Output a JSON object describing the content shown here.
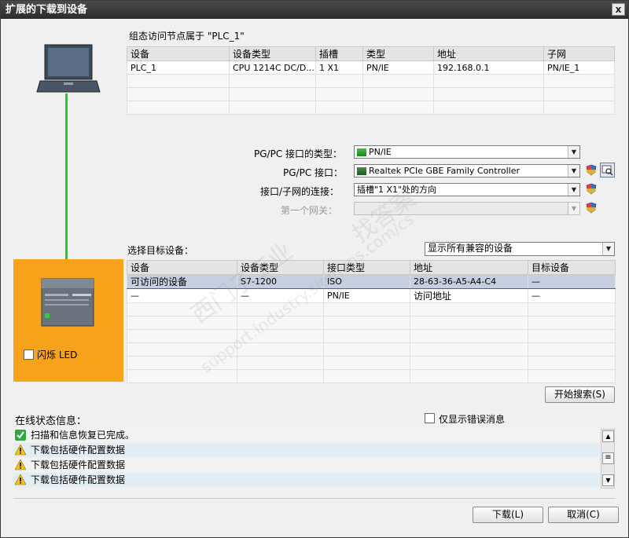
{
  "window": {
    "title": "扩展的下载到设备",
    "close_glyph": "x"
  },
  "config_table": {
    "caption": "组态访问节点属于 \"PLC_1\"",
    "headers": [
      "设备",
      "设备类型",
      "插槽",
      "类型",
      "地址",
      "子网"
    ],
    "rows": [
      [
        "PLC_1",
        "CPU 1214C DC/D...",
        "1 X1",
        "PN/IE",
        "192.168.0.1",
        "PN/IE_1"
      ]
    ]
  },
  "interface": {
    "type_label": "PG/PC 接口的类型：",
    "type_value": "PN/IE",
    "pgpc_label": "PG/PC 接口：",
    "pgpc_value": "Realtek PCIe GBE Family Controller",
    "conn_label": "接口/子网的连接：",
    "conn_value": "插槽\"1 X1\"处的方向",
    "gateway_label": "第一个网关：",
    "gateway_value": ""
  },
  "target": {
    "label": "选择目标设备：",
    "filter_value": "显示所有兼容的设备",
    "headers": [
      "设备",
      "设备类型",
      "接口类型",
      "地址",
      "目标设备"
    ],
    "rows": [
      [
        "可访问的设备",
        "S7-1200",
        "ISO",
        "28-63-36-A5-A4-C4",
        "—"
      ],
      [
        "—",
        "—",
        "PN/IE",
        "访问地址",
        "—"
      ]
    ]
  },
  "flash_led_label": "闪烁 LED",
  "start_search_label": "开始搜索(S)",
  "status": {
    "title": "在线状态信息：",
    "only_errors_label": "仅显示错误消息",
    "messages": [
      {
        "icon": "check-icon",
        "text": "扫描和信息恢复已完成。"
      },
      {
        "icon": "warning-icon",
        "text": "下载包括硬件配置数据"
      },
      {
        "icon": "warning-icon",
        "text": "下载包括硬件配置数据"
      },
      {
        "icon": "warning-icon",
        "text": "下载包括硬件配置数据"
      }
    ]
  },
  "footer": {
    "download_label": "下载(L)",
    "cancel_label": "取消(C)"
  },
  "watermark": {
    "line1": "西门子工业",
    "line2": "找答案",
    "line3": "support.industry.siemens.com/cs"
  },
  "colors": {
    "accent_orange": "#f7a21b",
    "link_green": "#22cc22",
    "selection": "#c5cfe0"
  }
}
